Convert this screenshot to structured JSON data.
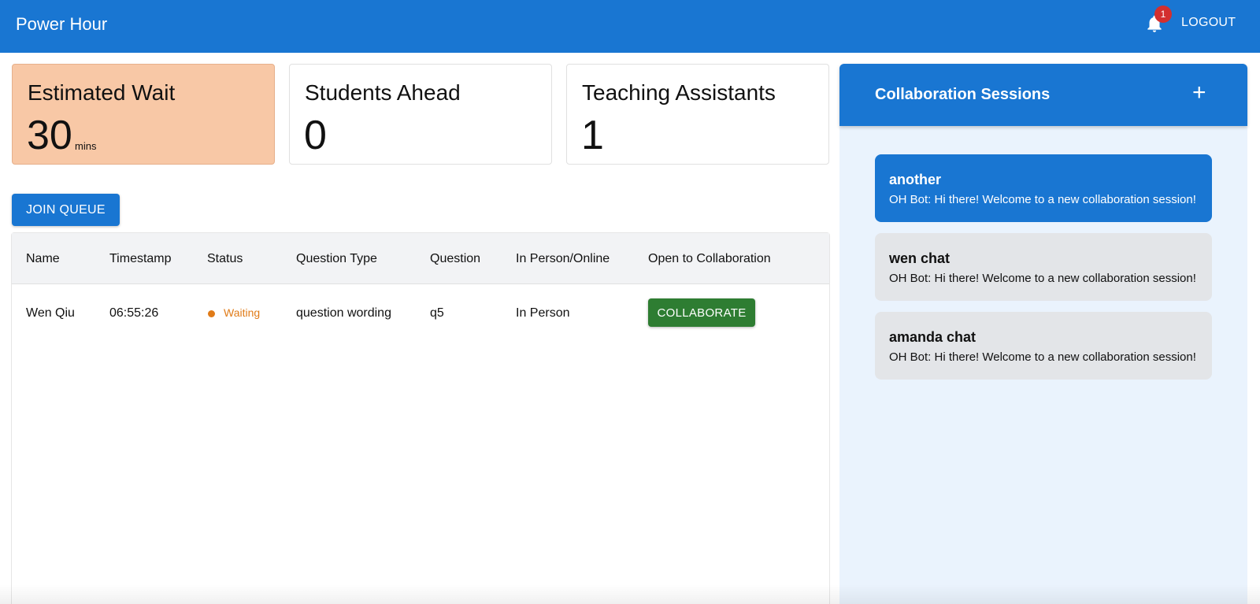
{
  "app": {
    "title": "Power Hour"
  },
  "header": {
    "notifications_count": "1",
    "logout_label": "LOGOUT"
  },
  "stats": [
    {
      "label": "Estimated Wait",
      "value": "30",
      "unit": "mins"
    },
    {
      "label": "Students Ahead",
      "value": "0"
    },
    {
      "label": "Teaching Assistants",
      "value": "1"
    }
  ],
  "queue": {
    "join_label": "JOIN QUEUE",
    "columns": [
      "Name",
      "Timestamp",
      "Status",
      "Question Type",
      "Question",
      "In Person/Online",
      "Open to Collaboration"
    ],
    "rows": [
      {
        "name": "Wen Qiu",
        "timestamp": "06:55:26",
        "status": "Waiting",
        "question_type": "question wording",
        "question": "q5",
        "mode": "In Person",
        "collab_label": "COLLABORATE"
      }
    ]
  },
  "collaboration": {
    "title": "Collaboration Sessions",
    "add_icon": "plus-icon",
    "sessions": [
      {
        "name": "another",
        "message": "OH Bot: Hi there! Welcome to a new collaboration session!"
      },
      {
        "name": "wen chat",
        "message": "OH Bot: Hi there! Welcome to a new collaboration session!"
      },
      {
        "name": "amanda chat",
        "message": "OH Bot: Hi there! Welcome to a new collaboration session!"
      }
    ]
  },
  "colors": {
    "primary": "#1976d2",
    "wait_card": "#f8c8a6",
    "waiting_status": "#e07b18",
    "collaborate_button": "#2e7d32",
    "badge": "#d32f2f"
  }
}
